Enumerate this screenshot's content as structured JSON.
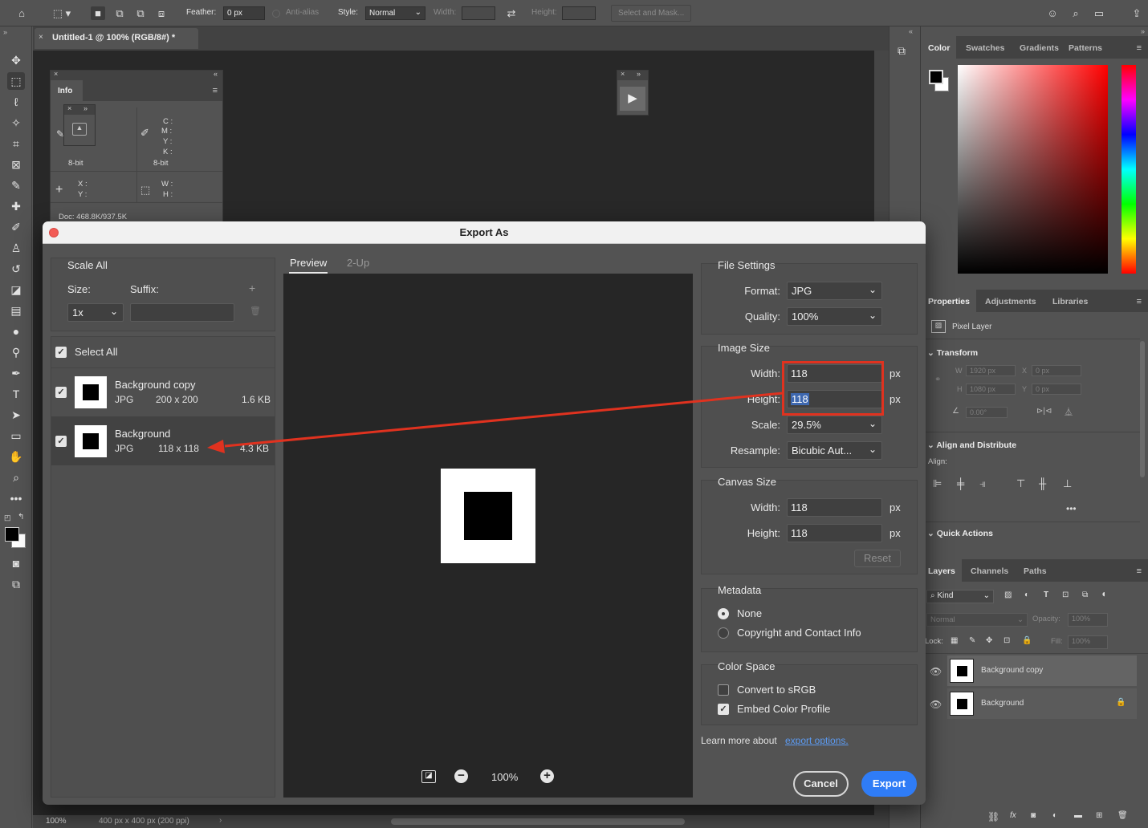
{
  "options_bar": {
    "feather_label": "Feather:",
    "feather_value": "0 px",
    "antialias_label": "Anti-alias",
    "style_label": "Style:",
    "style_value": "Normal",
    "width_label": "Width:",
    "height_label": "Height:",
    "select_mask_label": "Select and Mask..."
  },
  "document": {
    "tab_title": "Untitled-1 @ 100% (RGB/8#) *",
    "status_zoom": "100%",
    "status_info": "400 px x 400 px (200 ppi)"
  },
  "info_panel": {
    "tab": "Info",
    "bit_left": "8-bit",
    "bit_right": "8-bit",
    "cmyk": [
      "C :",
      "M :",
      "Y :",
      "K :"
    ],
    "xy": [
      "X :",
      "Y :"
    ],
    "wh": [
      "W :",
      "H :"
    ],
    "doc": "Doc: 468.8K/937.5K"
  },
  "color_panel": {
    "tabs": [
      "Color",
      "Swatches",
      "Gradients",
      "Patterns"
    ]
  },
  "properties_panel": {
    "tabs": [
      "Properties",
      "Adjustments",
      "Libraries"
    ],
    "layer_type": "Pixel Layer",
    "transform_title": "Transform",
    "w_label": "W",
    "w_value": "1920 px",
    "x_label": "X",
    "x_value": "0 px",
    "h_label": "H",
    "h_value": "1080 px",
    "y_label": "Y",
    "y_value": "0 px",
    "angle_value": "0.00°",
    "align_title": "Align and Distribute",
    "align_label": "Align:",
    "quick_actions_title": "Quick Actions"
  },
  "layers_panel": {
    "tabs": [
      "Layers",
      "Channels",
      "Paths"
    ],
    "kind_label": "Kind",
    "blend_mode": "Normal",
    "opacity_label": "Opacity:",
    "opacity_value": "100%",
    "lock_label": "Lock:",
    "fill_label": "Fill:",
    "fill_value": "100%",
    "layers": [
      {
        "name": "Background copy"
      },
      {
        "name": "Background"
      }
    ]
  },
  "dialog": {
    "title": "Export As",
    "scale_all": "Scale All",
    "size_label": "Size:",
    "suffix_label": "Suffix:",
    "size_value": "1x",
    "select_all": "Select All",
    "items": [
      {
        "name": "Background copy",
        "format": "JPG",
        "dims": "200 x 200",
        "size": "1.6 KB"
      },
      {
        "name": "Background",
        "format": "JPG",
        "dims": "118 x 118",
        "size": "4.3 KB"
      }
    ],
    "preview_tab": "Preview",
    "twoup_tab": "2-Up",
    "zoom": "100%",
    "file_settings": "File Settings",
    "format_label": "Format:",
    "format_value": "JPG",
    "quality_label": "Quality:",
    "quality_value": "100%",
    "image_size": "Image Size",
    "width_label": "Width:",
    "width_value": "118",
    "height_label": "Height:",
    "height_value": "118",
    "unit": "px",
    "scale_label": "Scale:",
    "scale_value": "29.5%",
    "resample_label": "Resample:",
    "resample_value": "Bicubic Aut...",
    "canvas_size": "Canvas Size",
    "canvas_width": "118",
    "canvas_height": "118",
    "reset": "Reset",
    "metadata": "Metadata",
    "meta_none": "None",
    "meta_copyright": "Copyright and Contact Info",
    "color_space": "Color Space",
    "convert_srgb": "Convert to sRGB",
    "embed_profile": "Embed Color Profile",
    "learn_more": "Learn more about",
    "export_options": "export options.",
    "cancel": "Cancel",
    "export": "Export"
  },
  "colors": {
    "accent_blue": "#2f7cf6",
    "annotation_red": "#e0321f"
  }
}
